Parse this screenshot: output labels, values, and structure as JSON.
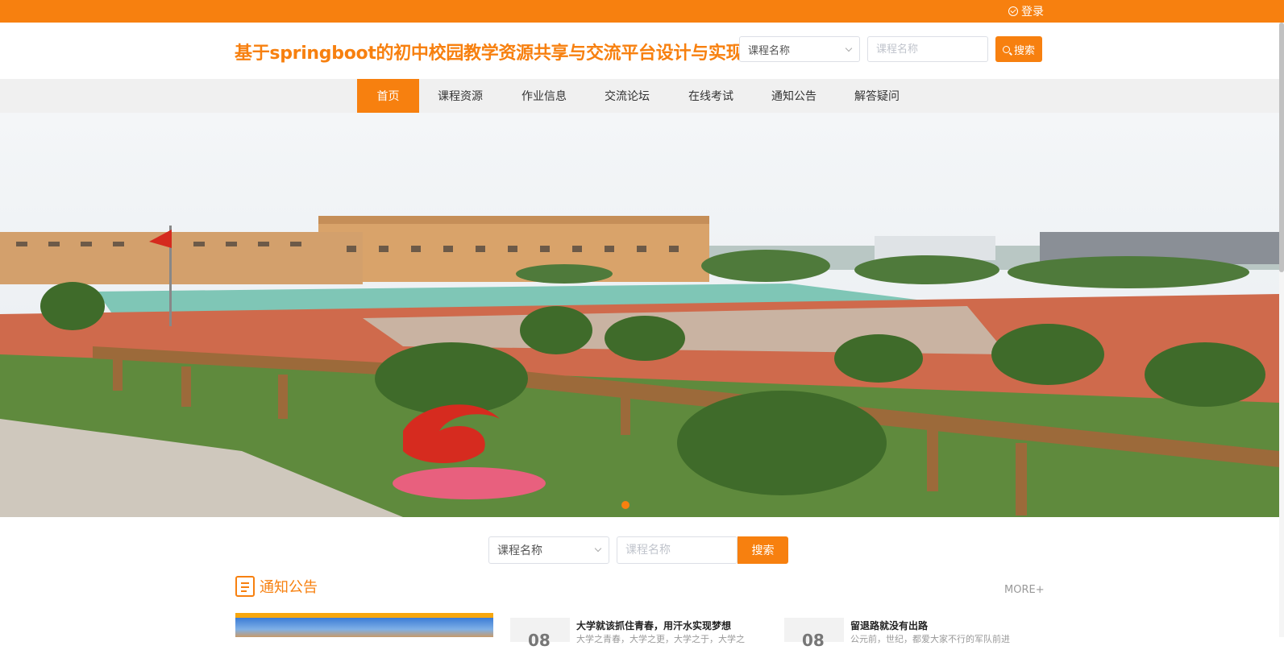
{
  "topbar": {
    "login_label": "登录"
  },
  "header": {
    "site_title": "基于springboot的初中校园教学资源共享与交流平台设计与实现",
    "select_value": "课程名称",
    "search_placeholder": "课程名称",
    "search_button": "搜索"
  },
  "nav": {
    "items": [
      {
        "label": "首页",
        "active": true
      },
      {
        "label": "课程资源"
      },
      {
        "label": "作业信息"
      },
      {
        "label": "交流论坛"
      },
      {
        "label": "在线考试"
      },
      {
        "label": "通知公告"
      },
      {
        "label": "解答疑问"
      }
    ]
  },
  "search2": {
    "select_value": "课程名称",
    "placeholder": "课程名称",
    "button": "搜索"
  },
  "notice": {
    "title": "通知公告",
    "more": "MORE+",
    "items": [
      {
        "title": "大学就该抓住青春，用汗水实现梦想",
        "summary": "大学之青春，大学之更，大学之于，大学之"
      },
      {
        "title": "留退路就没有出路",
        "summary": "公元前，世纪，都爱大家不行的军队前进"
      }
    ]
  },
  "colors": {
    "accent": "#f7800f"
  }
}
